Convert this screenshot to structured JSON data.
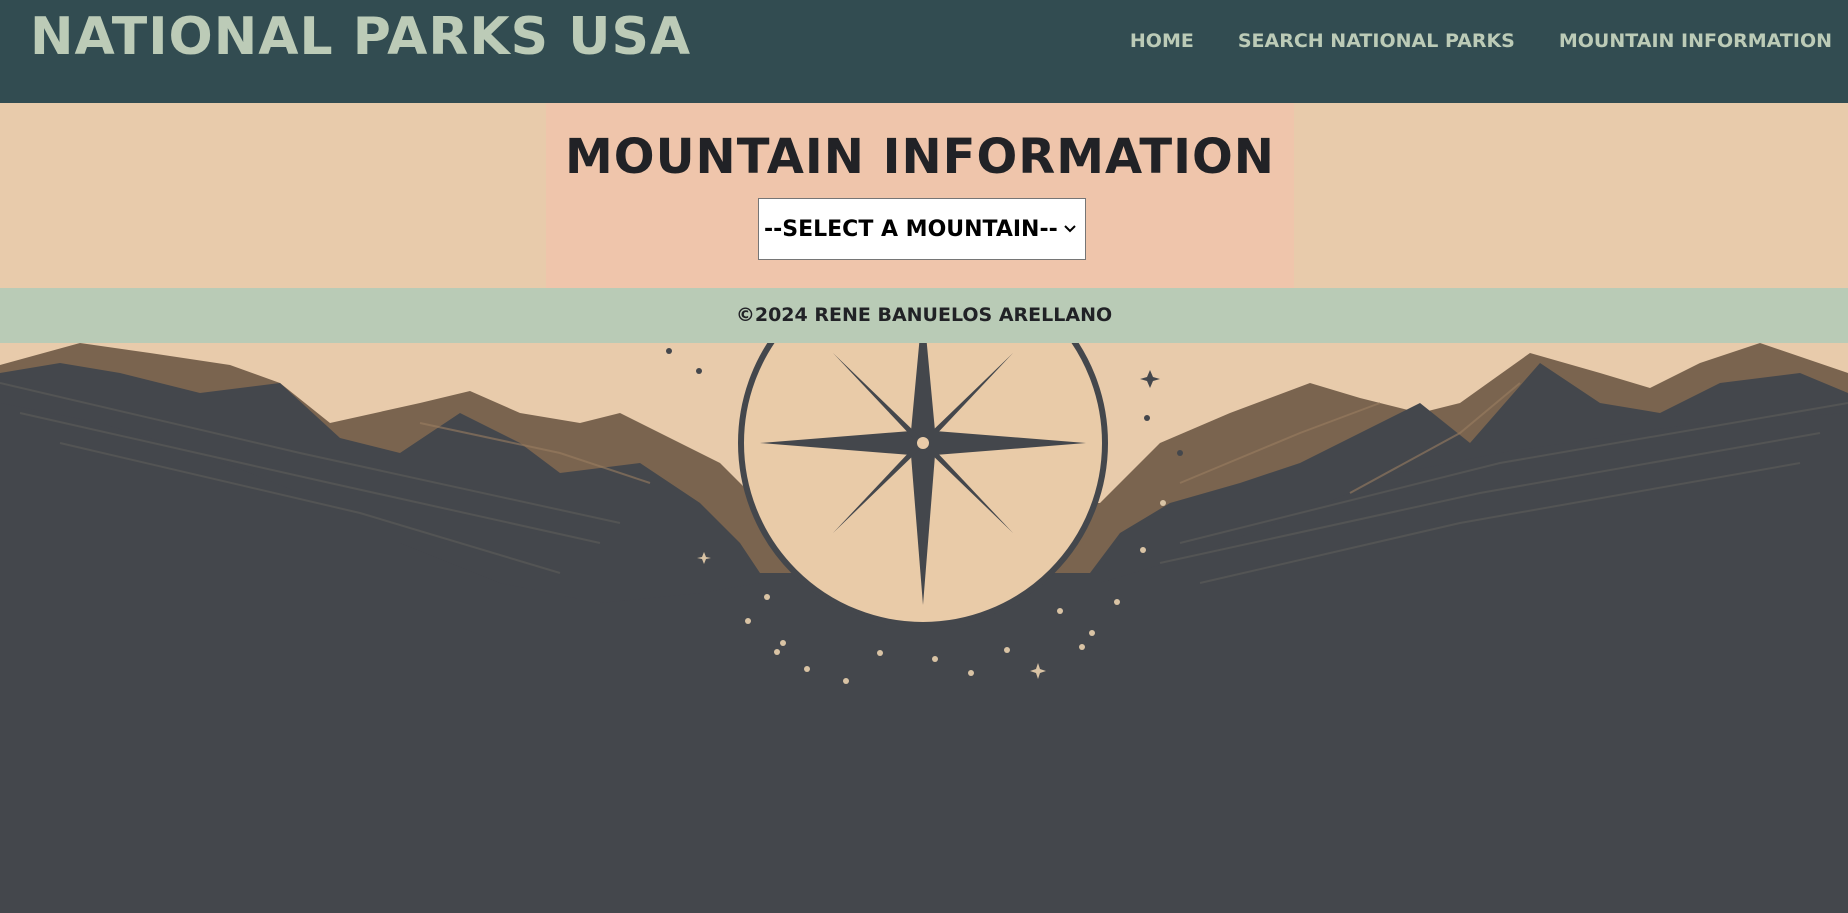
{
  "header": {
    "site_title": "NATIONAL PARKS USA",
    "nav": [
      {
        "label": "HOME"
      },
      {
        "label": "SEARCH NATIONAL PARKS"
      },
      {
        "label": "MOUNTAIN INFORMATION"
      }
    ]
  },
  "main": {
    "title": "MOUNTAIN INFORMATION",
    "mountain_select": {
      "selected": "--SELECT A MOUNTAIN--"
    }
  },
  "footer": {
    "copyright": "©2024 RENE BANUELOS ARELLANO"
  },
  "hero": {
    "icon": "compass-star-icon",
    "scene": "mountains-illustration"
  },
  "colors": {
    "header_bg": "#324c51",
    "header_text": "#bccbb7",
    "band_bg": "#e8cbab",
    "panel_bg": "#efc5ab",
    "footer_bg": "#b9cbb6",
    "dark_bg": "#44474c",
    "mountain_brown": "#7a644f"
  }
}
